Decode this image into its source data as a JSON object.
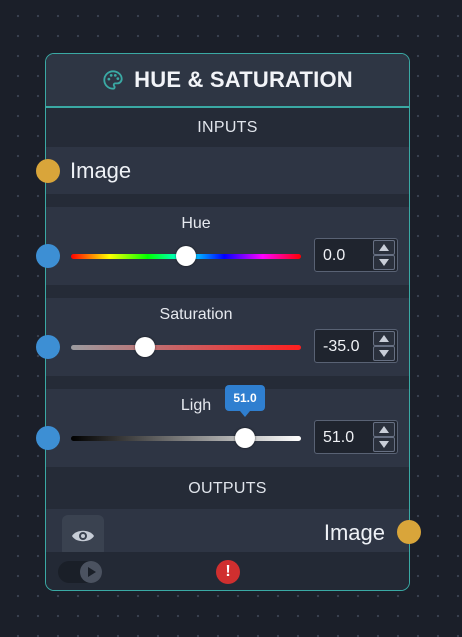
{
  "node": {
    "title": "HUE & SATURATION",
    "title_icon": "palette-icon",
    "accent_color": "#3aa9a4"
  },
  "inputs": {
    "section_label": "INPUTS",
    "image_label": "Image",
    "image_socket_color": "#d9a53a",
    "number_socket_color": "#3d8fd4"
  },
  "params": {
    "hue": {
      "label": "Hue",
      "value": "0.0",
      "min": -180,
      "max": 180,
      "numeric": 0.0
    },
    "saturation": {
      "label": "Saturation",
      "value": "-35.0",
      "min": -100,
      "max": 100,
      "numeric": -35.0
    },
    "lightness": {
      "label": "Ligh",
      "value": "51.0",
      "min": -100,
      "max": 100,
      "numeric": 51.0,
      "tooltip": "51.0"
    }
  },
  "outputs": {
    "section_label": "OUTPUTS",
    "image_label": "Image",
    "preview_icon": "eye-icon"
  },
  "footer": {
    "toggle_icon": "play-icon",
    "status_icon": "error-icon",
    "status_text": "!"
  }
}
